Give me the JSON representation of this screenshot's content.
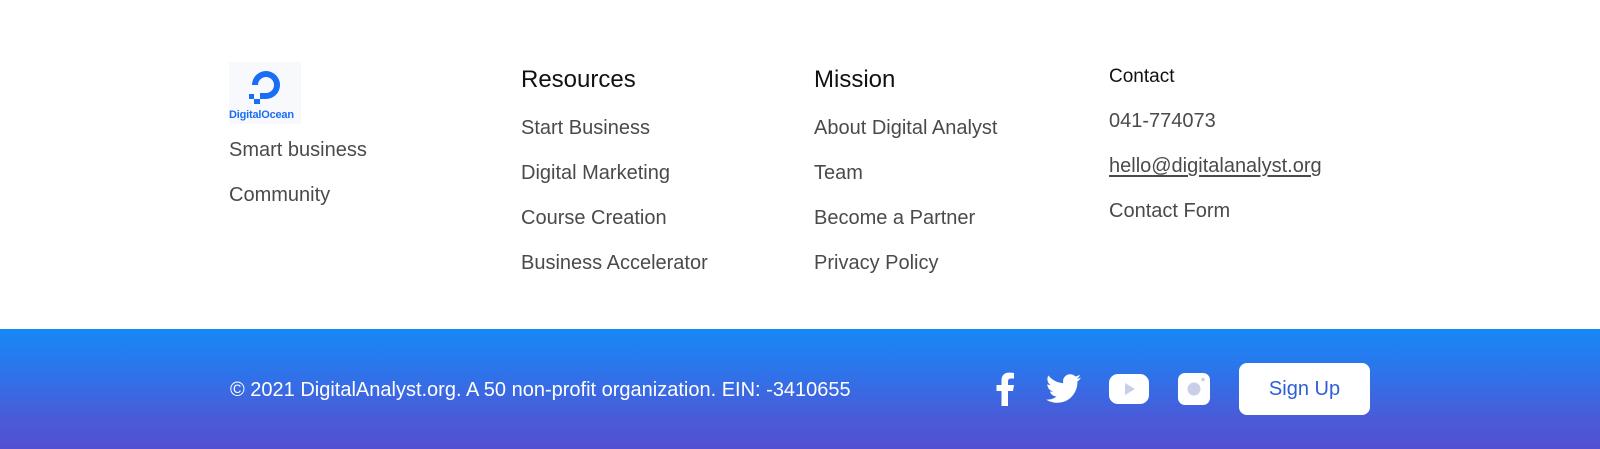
{
  "brand": {
    "logo_text": "DigitalOcean",
    "links": [
      "Smart business",
      "Community"
    ]
  },
  "resources": {
    "heading": "Resources",
    "links": [
      "Start Business",
      "Digital Marketing",
      "Course Creation",
      "Business Accelerator"
    ]
  },
  "mission": {
    "heading": "Mission",
    "links": [
      "About Digital Analyst",
      "Team",
      "Become a Partner",
      "Privacy Policy"
    ]
  },
  "contact": {
    "heading": "Contact",
    "phone": "041-774073",
    "email": "hello@digitalanalyst.org",
    "form": "Contact Form"
  },
  "bottom_bar": {
    "copyright": "© 2021 DigitalAnalyst.org. A 50 non-profit organization. EIN: -3410655",
    "social_icons": [
      "facebook-icon",
      "twitter-icon",
      "youtube-icon",
      "instagram-icon"
    ],
    "signup_label": "Sign Up"
  },
  "colors": {
    "brand_blue": "#1a6ef5",
    "gradient_top": "#1689f8",
    "gradient_bottom": "#5150d2",
    "link_gray": "#4a4a4a",
    "signup_text": "#2f5fd6"
  }
}
